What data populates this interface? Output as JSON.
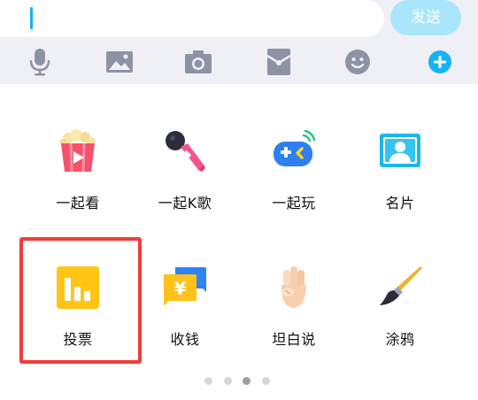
{
  "composer": {
    "input_value": "",
    "send_label": "发送"
  },
  "toolbar": {
    "items": [
      {
        "icon": "microphone-icon"
      },
      {
        "icon": "image-icon"
      },
      {
        "icon": "camera-icon"
      },
      {
        "icon": "red-packet-icon"
      },
      {
        "icon": "emoji-icon"
      },
      {
        "icon": "plus-icon"
      }
    ]
  },
  "apps": [
    {
      "label": "一起看",
      "icon": "popcorn-icon"
    },
    {
      "label": "一起K歌",
      "icon": "microphone-karaoke-icon"
    },
    {
      "label": "一起玩",
      "icon": "gamepad-icon"
    },
    {
      "label": "名片",
      "icon": "contact-card-icon"
    },
    {
      "label": "投票",
      "icon": "vote-chart-icon"
    },
    {
      "label": "收钱",
      "icon": "receive-money-icon"
    },
    {
      "label": "坦白说",
      "icon": "hand-icon"
    },
    {
      "label": "涂鸦",
      "icon": "brush-icon"
    }
  ],
  "pagination": {
    "pages": 4,
    "current": 3
  },
  "colors": {
    "accent": "#16b3f0",
    "highlight": "#f33b3b"
  }
}
